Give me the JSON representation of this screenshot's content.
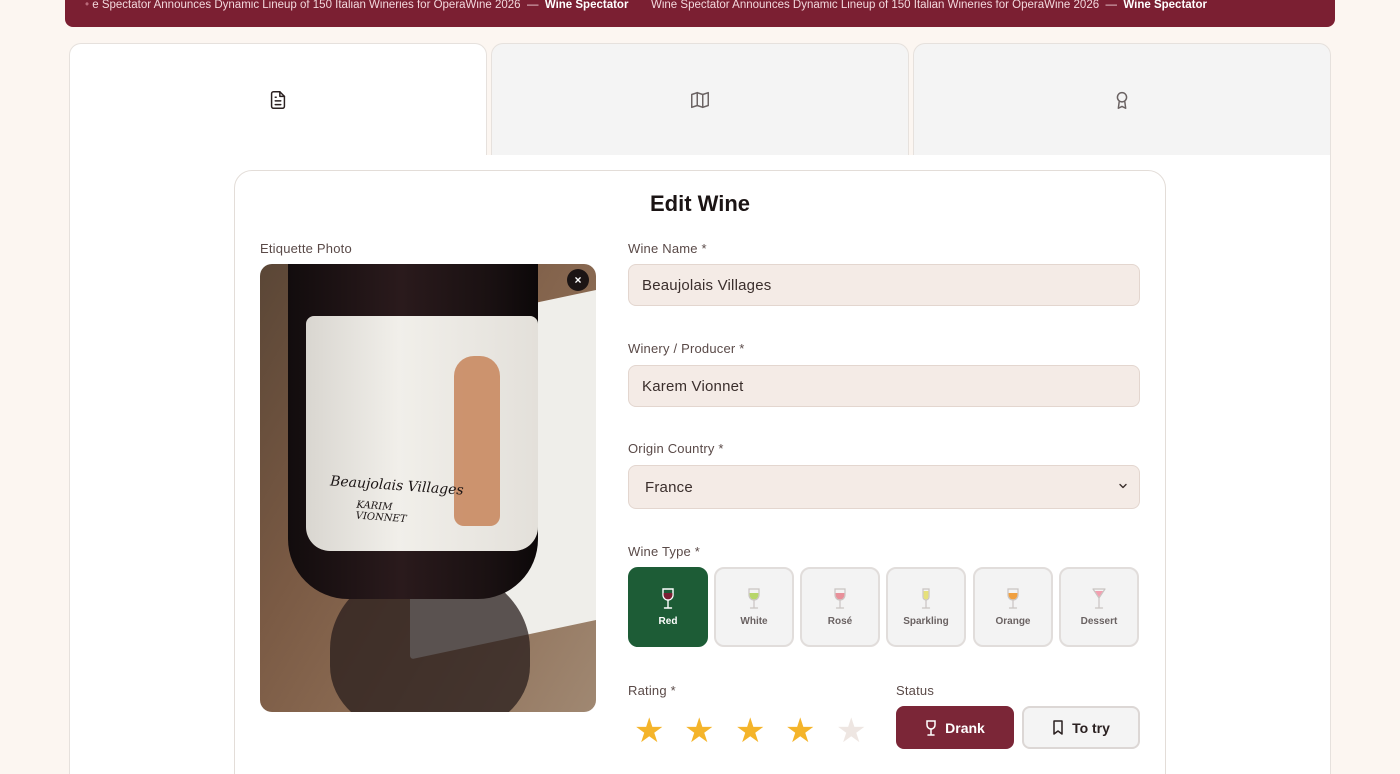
{
  "ticker": {
    "items": [
      {
        "headline": "e Spectator Announces Dynamic Lineup of 150 Italian Wineries for OperaWine 2026",
        "source": "Wine Spectator"
      },
      {
        "headline": "Wine Spectator Announces Dynamic Lineup of 150 Italian Wineries for OperaWine 2026",
        "source": "Wine Spectator"
      }
    ],
    "separator": "—"
  },
  "tabs": [
    {
      "icon": "document-icon",
      "active": true
    },
    {
      "icon": "map-icon",
      "active": false
    },
    {
      "icon": "award-icon",
      "active": false
    }
  ],
  "form": {
    "title": "Edit Wine",
    "photo_label": "Etiquette Photo",
    "photo_text": {
      "line1": "Beaujolais Villages",
      "line2": "KARIM VIONNET"
    },
    "remove_photo_glyph": "×",
    "wine_name": {
      "label": "Wine Name *",
      "value": "Beaujolais Villages"
    },
    "winery": {
      "label": "Winery / Producer *",
      "value": "Karem Vionnet"
    },
    "country": {
      "label": "Origin Country *",
      "value": "France"
    },
    "wine_type": {
      "label": "Wine Type *",
      "selected": "Red",
      "options": [
        {
          "label": "Red",
          "color": "#7b1f32"
        },
        {
          "label": "White",
          "color": "#b7d66a"
        },
        {
          "label": "Rosé",
          "color": "#e8909a"
        },
        {
          "label": "Sparkling",
          "color": "#e6e07a"
        },
        {
          "label": "Orange",
          "color": "#f0a040"
        },
        {
          "label": "Dessert",
          "color": "#f2a0b0"
        }
      ]
    },
    "rating": {
      "label": "Rating *",
      "value": 4,
      "max": 5
    },
    "status": {
      "label": "Status",
      "drank_label": "Drank",
      "to_try_label": "To try",
      "selected": "Drank"
    }
  },
  "colors": {
    "brand": "#7b1f32",
    "selected_type": "#1d5c36",
    "star": "#f4b42a",
    "field_bg": "#f4ebe6"
  }
}
